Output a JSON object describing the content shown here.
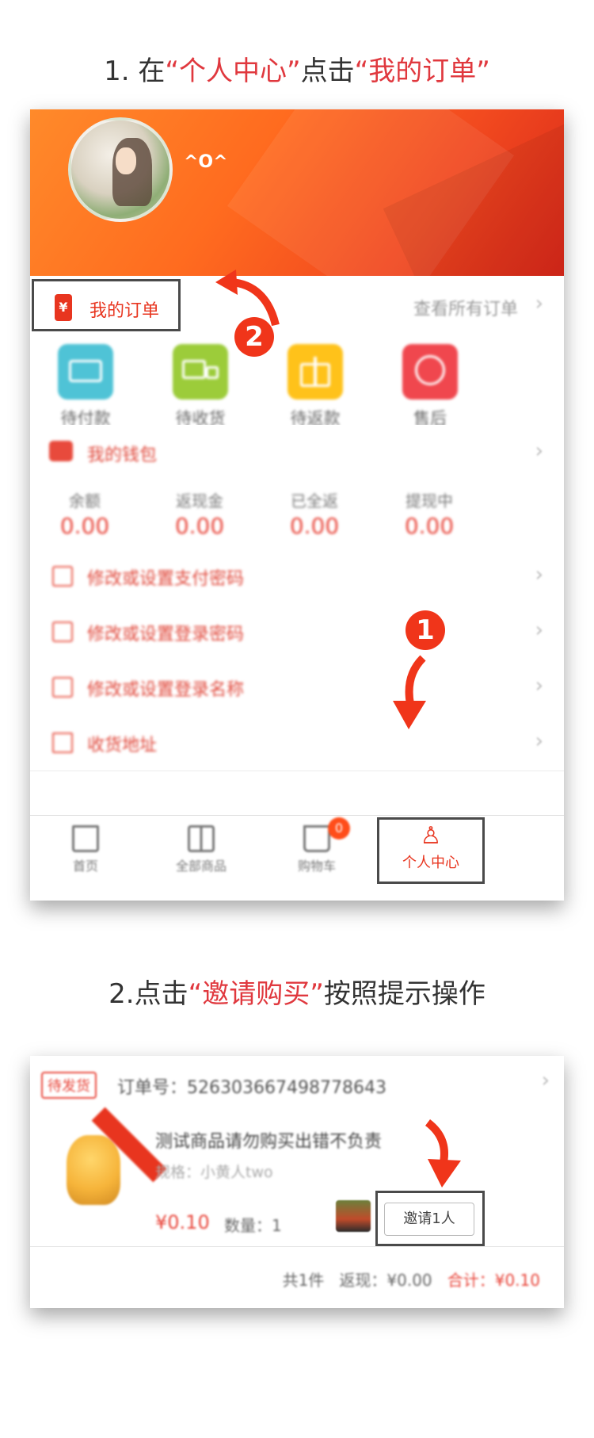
{
  "step1": {
    "prefix": "1. 在",
    "target1": "“个人中心”",
    "mid": "点击",
    "target2": "“我的订单”"
  },
  "step2": {
    "prefix": "2.点击",
    "target": "“邀请购买”",
    "suffix": "按照提示操作"
  },
  "profile": {
    "username": "^O^"
  },
  "orders": {
    "my_orders_label": "我的订单",
    "phone_icon_glyph": "¥",
    "view_all_label": "查看所有订单",
    "chevron": "›",
    "statuses": [
      {
        "label": "待付款",
        "icon": "card-icon",
        "color": "#4fc3d6"
      },
      {
        "label": "待收货",
        "icon": "truck-icon",
        "color": "#9ccc3a"
      },
      {
        "label": "待返款",
        "icon": "gift-icon",
        "color": "#ffc21a"
      },
      {
        "label": "售后",
        "icon": "headset-icon",
        "color": "#f0474e"
      }
    ]
  },
  "wallet": {
    "label": "我的钱包",
    "balances": [
      {
        "label": "余额",
        "value": "0.00"
      },
      {
        "label": "返现金",
        "value": "0.00"
      },
      {
        "label": "已全返",
        "value": "0.00"
      },
      {
        "label": "提现中",
        "value": "0.00"
      }
    ]
  },
  "settings": [
    {
      "label": "修改或设置支付密码"
    },
    {
      "label": "修改或设置登录密码"
    },
    {
      "label": "修改或设置登录名称"
    },
    {
      "label": "收货地址"
    }
  ],
  "tabbar": {
    "home": "首页",
    "all_products": "全部商品",
    "cart": "购物车",
    "cart_badge": "0",
    "me": "个人中心",
    "me_icon": "♙"
  },
  "markers": {
    "first": "1",
    "second": "2"
  },
  "order_detail": {
    "status_tag": "待发货",
    "order_number": "订单号：526303667498778643",
    "ribbon": "待发货",
    "product_name": "测试商品请勿购买出错不负责",
    "spec": "规格：小黄人two",
    "price": "¥0.10",
    "quantity": "数量：1",
    "invite_button": "邀请1人",
    "summary_count": "共1件",
    "summary_cashback": "返现：¥0.00",
    "summary_total": "合计：¥0.10"
  },
  "colors": {
    "accent": "#e0383e",
    "brand_orange": "#ff6b1f"
  }
}
